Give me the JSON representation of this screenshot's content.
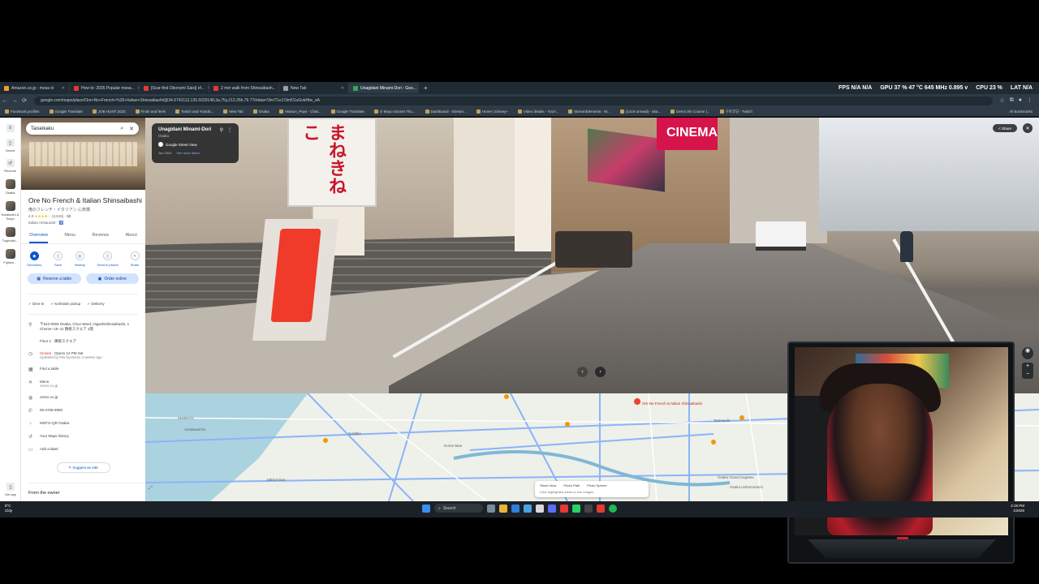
{
  "browser": {
    "tabs": [
      {
        "title": "Amazon.co.jp - mosa ni",
        "color": "#f0a030"
      },
      {
        "title": "How to: 2026 Popular mosa...",
        "color": "#e53935"
      },
      {
        "title": "[Scar-find Okonomi Salsi] ef...",
        "color": "#e53935"
      },
      {
        "title": "2 min walk from Shinsaibash...",
        "color": "#e53935"
      },
      {
        "title": "New Tab",
        "color": "#9aa0a6"
      },
      {
        "title": "Unagidani Minami-Dori - Goo...",
        "color": "#34a853",
        "active": true
      }
    ],
    "new_tab": "+",
    "stats": {
      "fps": "FPS N/A N/A",
      "gpu": "GPU 37 % 47 °C 645 MHz 0.895 v",
      "cpu": "CPU 23 %",
      "lat": "LAT N/A"
    },
    "url": "google.com/maps/place/Ore+No+French+%26+Italian+Shinsaibashi/@34.6743112,135.5020148,3a,75y,213.35h,79.77t/data=!3m7!1e1!3m5!1sGvbHtw_eA",
    "bookmarks": [
      "Facebook profiles",
      "Google Translate",
      "JOB HUNT 2023",
      "Finds and feels",
      "Twitch and Youtub...",
      "New Tab",
      "Osaka",
      "Akasun_Pays - Chat...",
      "Google Translate",
      "O Mayo Sunset Thu...",
      "Dashboard - Stream...",
      "Home | Disney+",
      "Video details - YouT...",
      "StreamElements - M...",
      "(1419 unread) - aka...",
      "Demo the Course |...",
      "구마코딩 - Twitch"
    ],
    "all_bookmarks": "All Bookmarks"
  },
  "rail": {
    "items": [
      {
        "label": "Saved",
        "icon": "bookmark-icon"
      },
      {
        "label": "Recents",
        "icon": "history-icon"
      },
      {
        "label": "Osaka",
        "icon": "thumb"
      },
      {
        "label": "Karakoshi & Tokyo",
        "icon": "thumb"
      },
      {
        "label": "Tugeodsi...",
        "icon": "thumb"
      },
      {
        "label": "Fujiken...",
        "icon": "thumb"
      }
    ],
    "get_app": "Get app"
  },
  "panel": {
    "search_value": "Taiseikaku",
    "name": "Ore No French & Italian Shinsaibashi",
    "subname": "俺のフレンチ・イタリアン 心斎橋",
    "rating": "4.0",
    "stars": "★★★★☆",
    "reviews": "(2,615) · $$",
    "type": "Italian restaurant · ♿",
    "tabs": [
      "Overview",
      "Menu",
      "Reviews",
      "About"
    ],
    "actions": [
      "Directions",
      "Save",
      "Nearby",
      "Send to phone",
      "Share"
    ],
    "reserve": "Reserve a table",
    "order": "Order online",
    "services": [
      "✓ Dine-in",
      "✓ Kerbside pickup",
      "✓ Delivery"
    ],
    "address": "〒542-0083 Osaka, Chuo Ward, Higashishinsaibashi, 1 Chome−19−11 隣接スクエア 1階",
    "floor": "Floor 1 · 隣接スクエア",
    "hours_status": "Closed",
    "hours_open": " · Opens 12 PM Sat",
    "hours_note": "Updated by this business 4 weeks ago",
    "find_table": "Find a table",
    "menu_label": "Menu",
    "menu_site": "oreno.co.jp",
    "website": "oreno.co.jp",
    "phone": "06-4708-5900",
    "plus_code": "MGF2+QR Osaka",
    "history": "Your Maps history",
    "label": "Add a label",
    "suggest": "Suggest an edit",
    "owner": "From the owner"
  },
  "streetview": {
    "title": "Unagidani Minami-Dori",
    "city": "Osaka",
    "brand": "Google Street View",
    "date": "Jun 2024",
    "more_dates": "See more dates",
    "share": "Share",
    "scene_sign": "まねきねこ",
    "scene_redsign": "CINEMA"
  },
  "map": {
    "poi_name": "Ore No French & Italian Shinsaibashi",
    "labels": [
      "SHIMAYA",
      "Aizakawacho",
      "NAMBA",
      "Dome-Mae",
      "Osaka Grand Kagetsu",
      "Tanimachi",
      "Osaka Uehommachi",
      "MEGA Don"
    ],
    "sv_tabs": [
      "Street View",
      "Photo Path",
      "Photo Sphere"
    ],
    "sv_note": "Click highlighted areas to see Images"
  },
  "taskbar": {
    "weather_temp": "8°C",
    "weather_desc": "Cldy",
    "search": "Search",
    "time": "2:19 PM",
    "date": "1/2026"
  }
}
